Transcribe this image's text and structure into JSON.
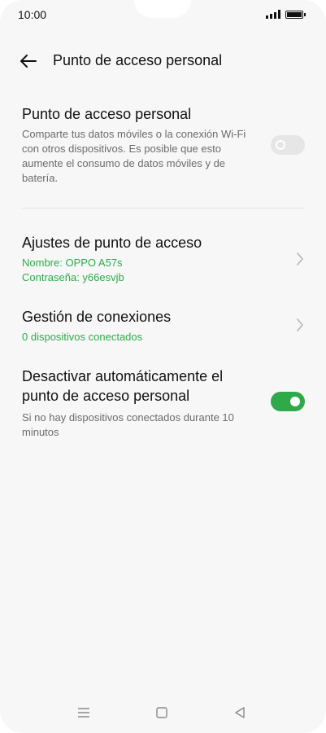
{
  "status_bar": {
    "time": "10:00",
    "icons": [
      "signal-icon",
      "battery-icon"
    ]
  },
  "header": {
    "back_icon": "arrow-left-icon",
    "title": "Punto de acceso personal"
  },
  "hotspot": {
    "title": "Punto de acceso personal",
    "description": "Comparte tus datos móviles o la conexión Wi-Fi con otros dispositivos. Es posible que esto aumente el consumo de datos móviles y de batería.",
    "enabled": false
  },
  "settings": {
    "title": "Ajustes de punto de acceso",
    "name_line": "Nombre: OPPO A57s",
    "password_line": "Contraseña: y66esvjb"
  },
  "connections": {
    "title": "Gestión de conexiones",
    "status": "0 dispositivos conectados"
  },
  "auto_off": {
    "title_line1": "Desactivar automáticamente el",
    "title_line2": "punto de acceso personal",
    "description": "Si no hay dispositivos conectados durante 10 minutos",
    "enabled": true
  },
  "nav": {
    "icons": [
      "menu-icon",
      "home-icon",
      "back-triangle-icon"
    ]
  },
  "colors": {
    "accent": "#2eaa4b",
    "background": "#f7f7f7",
    "secondary_text": "#6b6b6b"
  }
}
